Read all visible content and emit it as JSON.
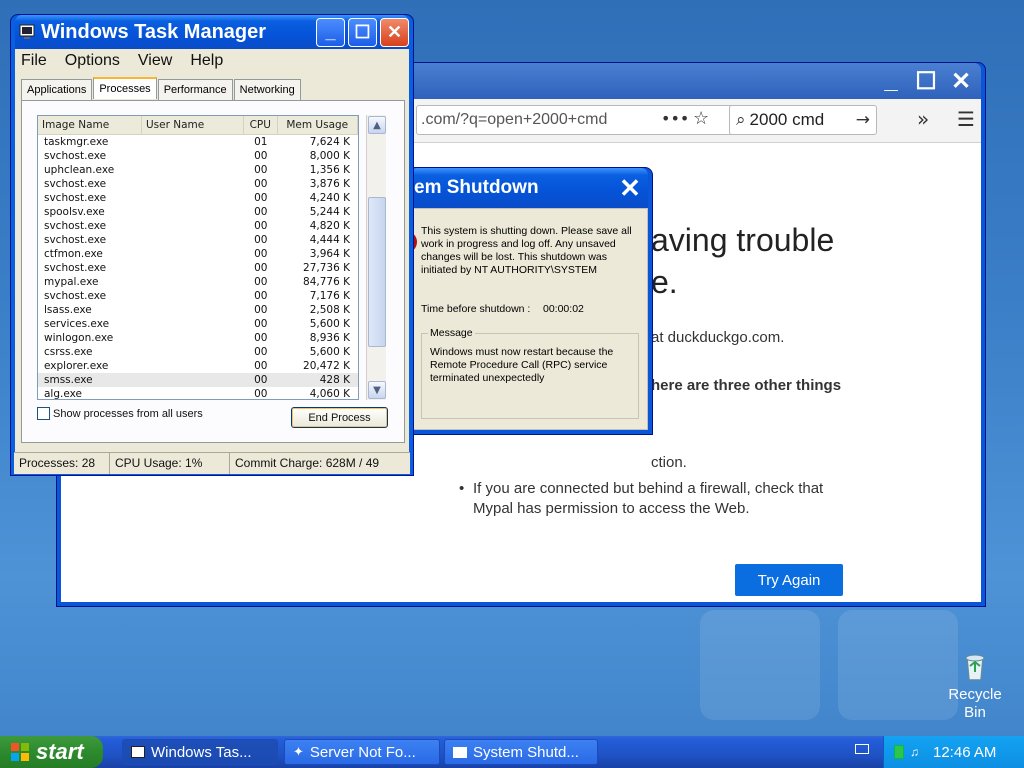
{
  "browser": {
    "url": ".com/?q=open+2000+cmd",
    "search": "2000 cmd",
    "heading_line1": "aving trouble",
    "heading_line2": "e.",
    "line_duck": "at duckduckgo.com.",
    "line_three": "here are three other things",
    "line_ction": "ction.",
    "bullet_line1": "If you are connected but behind a firewall, check that",
    "bullet_line2": "Mypal has permission to access the Web.",
    "try_again": "Try Again"
  },
  "shutdown": {
    "title": "em Shutdown",
    "message": "This system is shutting down. Please save all work in progress and log off. Any unsaved changes will be lost. This shutdown was initiated by NT AUTHORITY\\SYSTEM",
    "time_label": "Time before shutdown :",
    "time_value": "00:00:02",
    "group_label": "Message",
    "group_text": "Windows must now restart because the Remote Procedure Call (RPC) service terminated unexpectedly"
  },
  "taskmgr": {
    "title": "Windows Task Manager",
    "menu": [
      "File",
      "Options",
      "View",
      "Help"
    ],
    "tabs": [
      "Applications",
      "Processes",
      "Performance",
      "Networking"
    ],
    "columns": [
      "Image Name",
      "User Name",
      "CPU",
      "Mem Usage"
    ],
    "rows": [
      {
        "name": "taskmgr.exe",
        "user": "",
        "cpu": "01",
        "mem": "7,624 K"
      },
      {
        "name": "svchost.exe",
        "user": "",
        "cpu": "00",
        "mem": "8,000 K"
      },
      {
        "name": "uphclean.exe",
        "user": "",
        "cpu": "00",
        "mem": "1,356 K"
      },
      {
        "name": "svchost.exe",
        "user": "",
        "cpu": "00",
        "mem": "3,876 K"
      },
      {
        "name": "svchost.exe",
        "user": "",
        "cpu": "00",
        "mem": "4,240 K"
      },
      {
        "name": "spoolsv.exe",
        "user": "",
        "cpu": "00",
        "mem": "5,244 K"
      },
      {
        "name": "svchost.exe",
        "user": "",
        "cpu": "00",
        "mem": "4,820 K"
      },
      {
        "name": "svchost.exe",
        "user": "",
        "cpu": "00",
        "mem": "4,444 K"
      },
      {
        "name": "ctfmon.exe",
        "user": "",
        "cpu": "00",
        "mem": "3,964 K"
      },
      {
        "name": "svchost.exe",
        "user": "",
        "cpu": "00",
        "mem": "27,736 K"
      },
      {
        "name": "mypal.exe",
        "user": "",
        "cpu": "00",
        "mem": "84,776 K"
      },
      {
        "name": "svchost.exe",
        "user": "",
        "cpu": "00",
        "mem": "7,176 K"
      },
      {
        "name": "lsass.exe",
        "user": "",
        "cpu": "00",
        "mem": "2,508 K"
      },
      {
        "name": "services.exe",
        "user": "",
        "cpu": "00",
        "mem": "5,600 K"
      },
      {
        "name": "winlogon.exe",
        "user": "",
        "cpu": "00",
        "mem": "8,936 K"
      },
      {
        "name": "csrss.exe",
        "user": "",
        "cpu": "00",
        "mem": "5,600 K"
      },
      {
        "name": "explorer.exe",
        "user": "",
        "cpu": "00",
        "mem": "20,472 K"
      },
      {
        "name": "smss.exe",
        "user": "",
        "cpu": "00",
        "mem": "428 K"
      },
      {
        "name": "alg.exe",
        "user": "",
        "cpu": "00",
        "mem": "4,060 K"
      }
    ],
    "show_all_label": "Show processes from all users",
    "end_process": "End Process",
    "status_processes": "Processes: 28",
    "status_cpu": "CPU Usage: 1%",
    "status_commit": "Commit Charge: 628M / 49"
  },
  "taskbar": {
    "start": "start",
    "buttons": [
      "Windows Tas...",
      "Server Not Fo...",
      "System Shutd..."
    ],
    "clock": "12:46 AM"
  },
  "desktop": {
    "recycle_line1": "Recycle",
    "recycle_line2": "Bin"
  },
  "colors": {
    "xp_blue": "#0a55d8",
    "try_again": "#0a6ee0",
    "start_green": "#2e8a2e"
  }
}
